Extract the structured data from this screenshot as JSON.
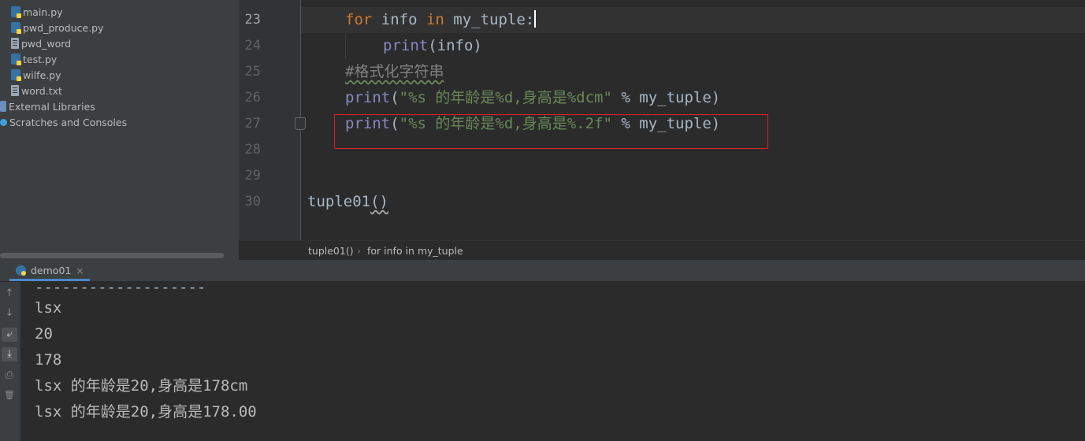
{
  "project_tree": {
    "items": [
      {
        "label": "main.py",
        "type": "python"
      },
      {
        "label": "pwd_produce.py",
        "type": "python"
      },
      {
        "label": "pwd_word",
        "type": "file"
      },
      {
        "label": "test.py",
        "type": "python"
      },
      {
        "label": "wilfe.py",
        "type": "python"
      },
      {
        "label": "word.txt",
        "type": "file"
      },
      {
        "label": "External Libraries",
        "type": "library"
      },
      {
        "label": "Scratches and Consoles",
        "type": "scratch"
      }
    ]
  },
  "editor": {
    "line_numbers": [
      "23",
      "24",
      "25",
      "26",
      "27",
      "28",
      "29",
      "30"
    ],
    "lines": {
      "l23_kw_for": "for",
      "l23_var": " info ",
      "l23_kw_in": "in",
      "l23_rest": " my_tuple:",
      "l24_print": "print",
      "l24_rest": "(info)",
      "l25_comment": "#格式化字符串",
      "l26_print": "print",
      "l26_open": "(",
      "l26_str": "\"%s 的年龄是%d,身高是%dcm\"",
      "l26_rest": " % my_tuple)",
      "l27_print": "print",
      "l27_open": "(",
      "l27_str": "\"%s 的年龄是%d,身高是%.2f\"",
      "l27_rest": " % my_tuple)",
      "l30_name": "tuple01",
      "l30_parens": "()"
    },
    "highlight_color": "#e02020"
  },
  "breadcrumb": {
    "func": "tuple01()",
    "separator": "›",
    "block": "for info in my_tuple"
  },
  "run_panel": {
    "tab_label": "demo01",
    "tab_close": "×",
    "toolbar": {
      "up": "↑",
      "down": "↓",
      "wrap": "⤶",
      "scroll_end": "⤓",
      "print": "⎙",
      "trash": "🗑"
    },
    "dashes": "-------------------",
    "output": [
      "lsx",
      "20",
      "178",
      "lsx 的年龄是20,身高是178cm",
      "lsx 的年龄是20,身高是178.00"
    ]
  }
}
